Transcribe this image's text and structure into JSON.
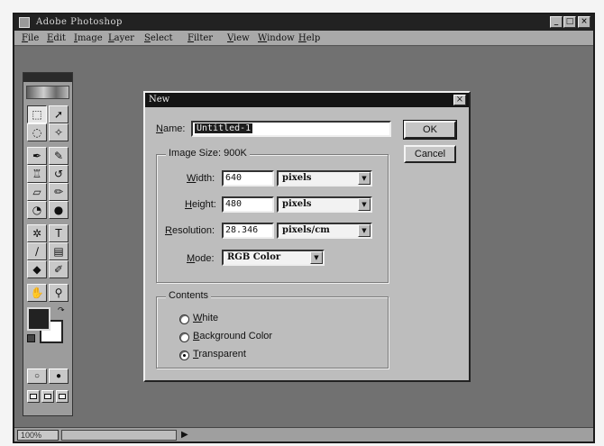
{
  "app": {
    "title": "Adobe Photoshop",
    "window_buttons": [
      "_",
      "□",
      "×"
    ]
  },
  "menu": [
    "File",
    "Edit",
    "Image",
    "Layer",
    "Select",
    "Filter",
    "View",
    "Window",
    "Help"
  ],
  "toolbox": {
    "tools": [
      {
        "name": "marquee-tool-icon",
        "glyph": "⬚",
        "active": true
      },
      {
        "name": "move-tool-icon",
        "glyph": "➚"
      },
      {
        "name": "lasso-tool-icon",
        "glyph": "◌"
      },
      {
        "name": "magic-wand-tool-icon",
        "glyph": "✧"
      },
      {
        "name": "airbrush-tool-icon",
        "glyph": "✒"
      },
      {
        "name": "paintbrush-tool-icon",
        "glyph": "✎"
      },
      {
        "name": "rubber-stamp-tool-icon",
        "glyph": "♖"
      },
      {
        "name": "history-brush-tool-icon",
        "glyph": "↺"
      },
      {
        "name": "eraser-tool-icon",
        "glyph": "▱"
      },
      {
        "name": "pencil-tool-icon",
        "glyph": "✏"
      },
      {
        "name": "blur-tool-icon",
        "glyph": "◔"
      },
      {
        "name": "dodge-tool-icon",
        "glyph": "●"
      },
      {
        "name": "pen-tool-icon",
        "glyph": "✲"
      },
      {
        "name": "type-tool-icon",
        "glyph": "T"
      },
      {
        "name": "line-tool-icon",
        "glyph": "∕"
      },
      {
        "name": "gradient-tool-icon",
        "glyph": "▤"
      },
      {
        "name": "paint-bucket-tool-icon",
        "glyph": "◆"
      },
      {
        "name": "eyedropper-tool-icon",
        "glyph": "✐"
      },
      {
        "name": "hand-tool-icon",
        "glyph": "✋"
      },
      {
        "name": "zoom-tool-icon",
        "glyph": "⚲"
      }
    ],
    "mode_icons": [
      "○",
      "●"
    ]
  },
  "dialog": {
    "title": "New",
    "name_label": "Name:",
    "name_value": "Untitled-1",
    "ok_label": "OK",
    "cancel_label": "Cancel",
    "image_size_label": "Image Size: 900K",
    "width_label": "Width:",
    "width_value": "640",
    "width_unit": "pixels",
    "height_label": "Height:",
    "height_value": "480",
    "height_unit": "pixels",
    "resolution_label": "Resolution:",
    "resolution_value": "28.346",
    "resolution_unit": "pixels/cm",
    "mode_label": "Mode:",
    "mode_value": "RGB Color",
    "contents_label": "Contents",
    "contents_options": [
      {
        "label": "White",
        "checked": false
      },
      {
        "label": "Background Color",
        "checked": false
      },
      {
        "label": "Transparent",
        "checked": true
      }
    ]
  },
  "statusbar": {
    "zoom": "100%"
  }
}
